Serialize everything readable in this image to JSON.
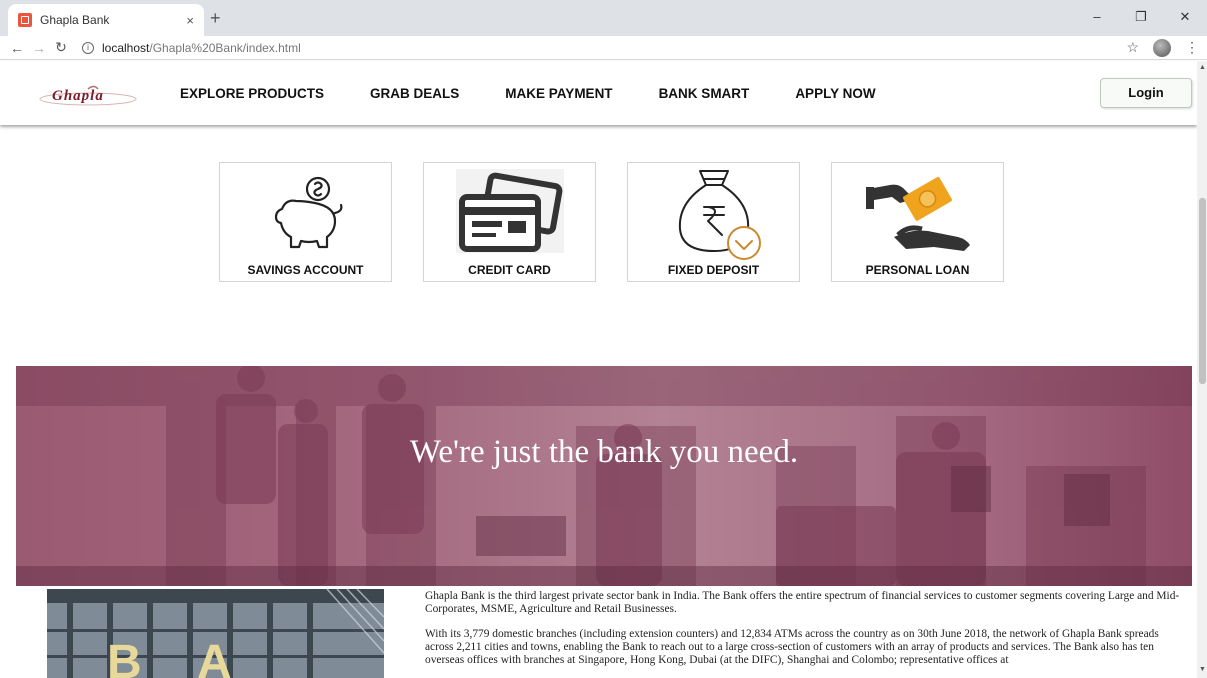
{
  "browser": {
    "tab_title": "Ghapla Bank",
    "tab_close": "×",
    "new_tab": "+",
    "url_host": "localhost",
    "url_path": "/Ghapla%20Bank/index.html"
  },
  "header": {
    "logo_text": "Ghapla",
    "nav": [
      "EXPLORE PRODUCTS",
      "GRAB DEALS",
      "MAKE PAYMENT",
      "BANK SMART",
      "APPLY NOW"
    ],
    "login_label": "Login"
  },
  "products": [
    {
      "label": "SAVINGS ACCOUNT",
      "icon": "piggy-bank-icon"
    },
    {
      "label": "CREDIT CARD",
      "icon": "credit-card-icon"
    },
    {
      "label": "FIXED DEPOSIT",
      "icon": "money-bag-icon"
    },
    {
      "label": "PERSONAL LOAN",
      "icon": "loan-hand-icon"
    }
  ],
  "hero": {
    "heading": "We're just the bank you need."
  },
  "about": {
    "p1": "Ghapla Bank is the third largest private sector bank in India. The Bank offers the entire spectrum of financial services to customer segments covering Large and Mid-Corporates, MSME, Agriculture and Retail Businesses.",
    "p2": "With its 3,779 domestic branches (including extension counters) and 12,834 ATMs across the country as on 30th June 2018, the network of Ghapla Bank spreads across 2,211 cities and towns, enabling the Bank to reach out to a large cross-section of customers with an array of products and services. The Bank also has ten overseas offices with branches at Singapore, Hong Kong, Dubai (at the DIFC), Shanghai and Colombo; representative offices at"
  },
  "colors": {
    "hero_tint": "#a4687f",
    "loan_orange": "#f0a31c",
    "logo_maroon": "#7a1c2a"
  }
}
